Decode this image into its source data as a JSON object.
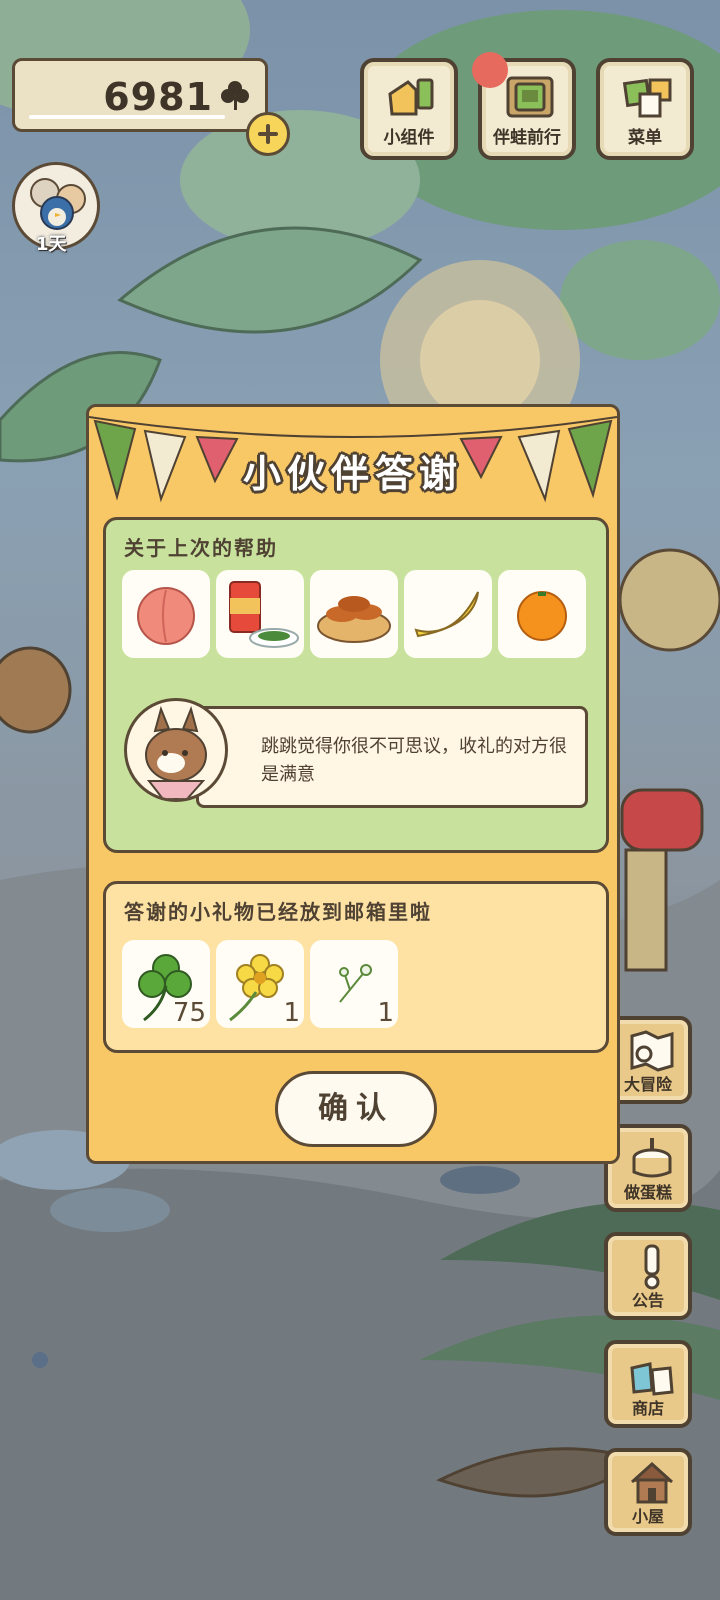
{
  "currency": {
    "amount": "6981",
    "icon": "clover-icon"
  },
  "avatar": {
    "day_label": "1天"
  },
  "top_buttons": [
    {
      "label": "小组件",
      "icon": "widget-icon"
    },
    {
      "label": "伴蛙前行",
      "icon": "journal-icon",
      "has_notification": true
    },
    {
      "label": "菜单",
      "icon": "menu-cards-icon"
    }
  ],
  "side_buttons": [
    {
      "label": "大冒险",
      "icon": "map-icon"
    },
    {
      "label": "做蛋糕",
      "icon": "cake-icon"
    },
    {
      "label": "公告",
      "icon": "exclamation-icon"
    },
    {
      "label": "商店",
      "icon": "bags-icon"
    },
    {
      "label": "小屋",
      "icon": "house-icon"
    }
  ],
  "dialog": {
    "title": "小伙伴答谢",
    "section1": {
      "title": "关于上次的帮助",
      "items": [
        "peach-icon",
        "canned-food-icon",
        "fried-dough-icon",
        "banana-icon",
        "orange-icon"
      ],
      "message": "跳跳觉得你很不可思议，收礼的对方很是满意"
    },
    "section2": {
      "title": "答谢的小礼物已经放到邮箱里啦",
      "gifts": [
        {
          "icon": "clover-icon",
          "qty": "75"
        },
        {
          "icon": "yellow-flower-icon",
          "qty": "1"
        },
        {
          "icon": "white-flower-icon",
          "qty": "1"
        }
      ]
    },
    "confirm_label": "确认"
  },
  "colors": {
    "dialog_bg": "#f8c766",
    "panel_green": "#c8e29e",
    "panel_yellow": "#fde2a4",
    "outline": "#5b4a36"
  }
}
